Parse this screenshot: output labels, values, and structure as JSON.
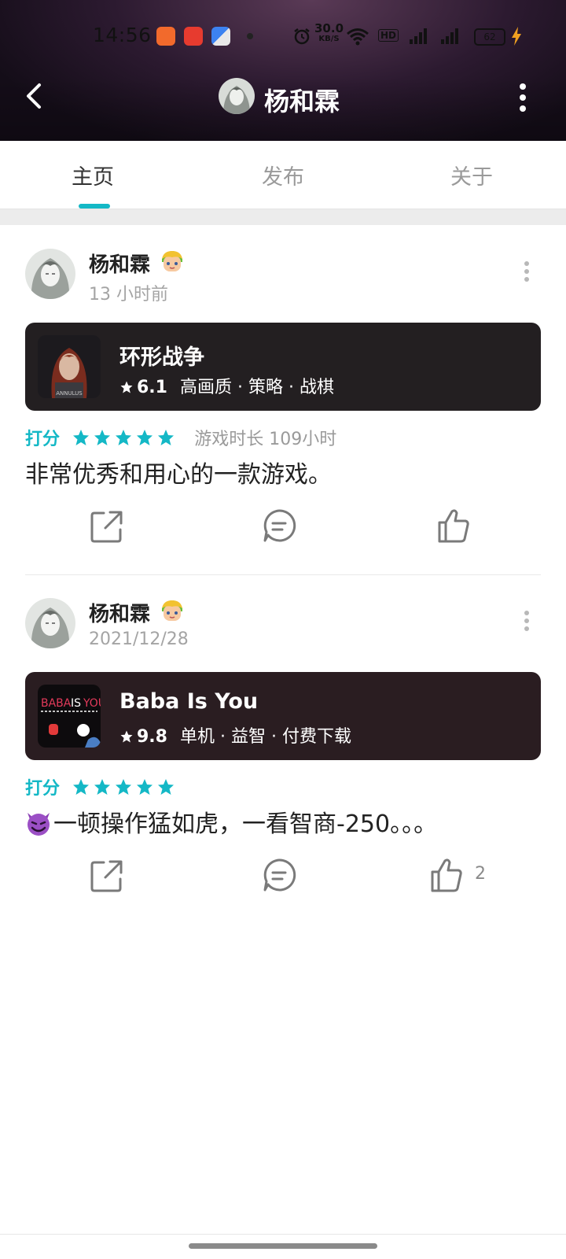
{
  "status_bar": {
    "time": "14:56",
    "net_speed_value": "30.0",
    "net_speed_unit": "KB/S",
    "hd_label": "HD",
    "battery_level": "62"
  },
  "header": {
    "title": "杨和霖",
    "accent_color": "#14b8c6"
  },
  "tabs": [
    {
      "label": "主页",
      "active": true
    },
    {
      "label": "发布",
      "active": false
    },
    {
      "label": "关于",
      "active": false
    }
  ],
  "posts": [
    {
      "author": "杨和霖",
      "time": "13 小时前",
      "game": {
        "title": "环形战争",
        "rating": "6.1",
        "tags": "高画质 · 策略 · 战棋",
        "cover_text": "ANNULUS"
      },
      "rating_label": "打分",
      "star_count": 5,
      "play_time": "游戏时长 109小时",
      "text": "非常优秀和用心的一款游戏。",
      "like_count": ""
    },
    {
      "author": "杨和霖",
      "time": "2021/12/28",
      "game": {
        "title": "Baba Is You",
        "rating": "9.8",
        "tags": "单机 · 益智 · 付费下载",
        "cover_text_1": "BABA",
        "cover_text_2": "IS",
        "cover_text_3": "YOU"
      },
      "rating_label": "打分",
      "star_count": 5,
      "play_time": "",
      "text": "一顿操作猛如虎，一看智商-250。。。",
      "like_count": "2"
    }
  ]
}
